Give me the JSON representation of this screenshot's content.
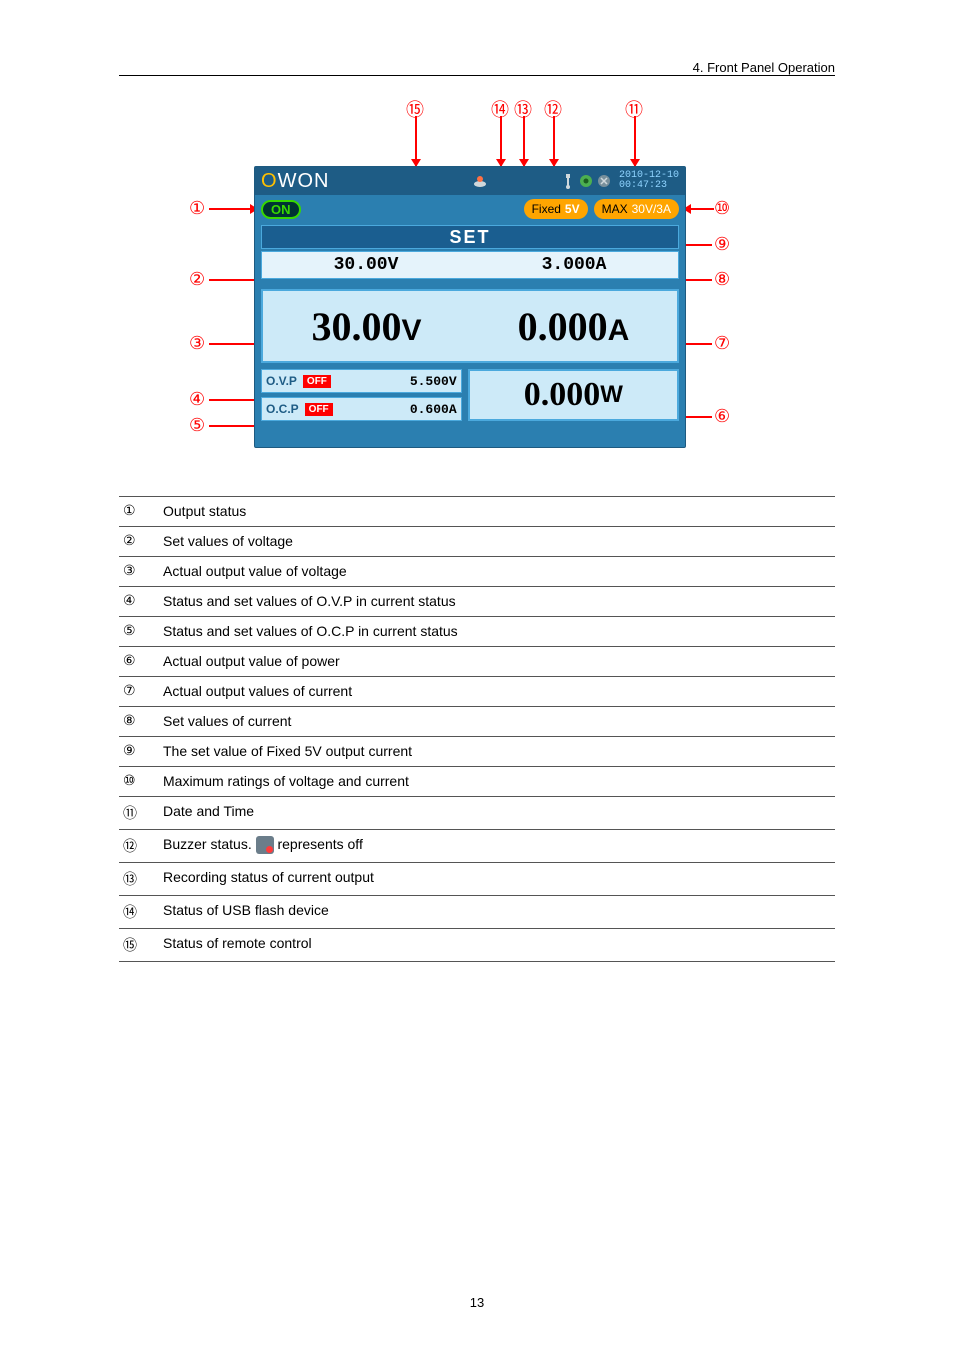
{
  "section": {
    "title": "4. Front Panel Operation",
    "page": "13"
  },
  "fig": {
    "brand": "OWON",
    "datetime": {
      "date": "2010-12-10",
      "time": "00:47:23"
    },
    "on": "ON",
    "fixed": {
      "label": "Fixed",
      "value": "5V"
    },
    "max": {
      "label": "MAX",
      "value": "30V/3A"
    },
    "set_label": "SET",
    "set_v": "30.00V",
    "set_a": "3.000A",
    "out_v_num": "30.00",
    "out_v_unit": "V",
    "out_a_num": "0.000",
    "out_a_unit": "A",
    "ovp": {
      "label": "O.V.P",
      "state": "OFF",
      "val": "5.500V"
    },
    "ocp": {
      "label": "O.C.P",
      "state": "OFF",
      "val": "0.600A"
    },
    "watt_num": "0.000",
    "watt_unit": "W"
  },
  "callouts": {
    "c1": "①",
    "c2": "②",
    "c3": "③",
    "c4": "④",
    "c5": "⑤",
    "c6": "⑥",
    "c7": "⑦",
    "c8": "⑧",
    "c9": "⑨",
    "c10": "⑩",
    "c11": "⑪",
    "c12": "⑫",
    "c13": "⑬",
    "c14": "⑭",
    "c15": "⑮"
  },
  "defs": [
    {
      "n": "①",
      "t": "Output status"
    },
    {
      "n": "②",
      "t": "Set values of voltage"
    },
    {
      "n": "③",
      "t": "Actual output value of voltage"
    },
    {
      "n": "④",
      "t": "Status and set values of O.V.P in current status"
    },
    {
      "n": "⑤",
      "t": "Status and set values of O.C.P in current status"
    },
    {
      "n": "⑥",
      "t": "Actual output value of power"
    },
    {
      "n": "⑦",
      "t": "Actual output values of current"
    },
    {
      "n": "⑧",
      "t": "Set values of current"
    },
    {
      "n": "⑨",
      "t": "The set value of Fixed 5V output current"
    },
    {
      "n": "⑩",
      "t": "Maximum ratings of voltage and current"
    },
    {
      "n": "⑪",
      "t": "Date and Time"
    },
    {
      "n": "⑫",
      "t": "Buzzer status. ",
      "icon": true,
      "t2": " represents off "
    },
    {
      "n": "⑬",
      "t": "Recording status of current output"
    },
    {
      "n": "⑭",
      "t": "Status of USB flash device"
    },
    {
      "n": "⑮",
      "t": "Status of remote control"
    }
  ]
}
